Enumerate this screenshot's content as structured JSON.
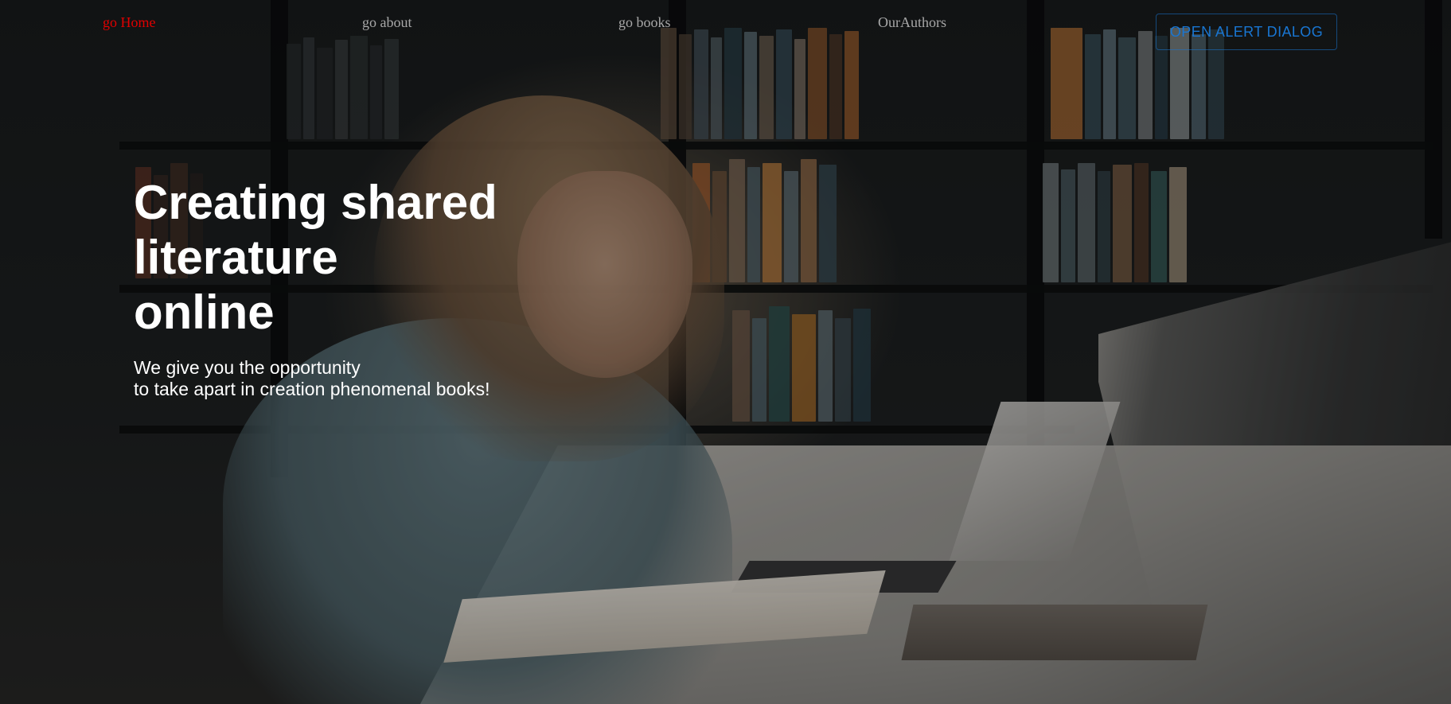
{
  "nav": {
    "items": [
      {
        "label": "go Home",
        "active": true
      },
      {
        "label": "go about",
        "active": false
      },
      {
        "label": "go books",
        "active": false
      },
      {
        "label": "OurAuthors",
        "active": false
      }
    ],
    "alert_button_label": "OPEN ALERT DIALOG"
  },
  "hero": {
    "title_line1": "Creating shared",
    "title_line2": "literature",
    "title_line3": "online",
    "subtitle_line1": "We give you the opportunity",
    "subtitle_line2": "to take apart in creation phenomenal books!",
    "background_image": "library-student-writing"
  },
  "colors": {
    "nav_active": "#e00000",
    "nav_inactive": "#a8a8a8",
    "button_accent": "#1976d2",
    "hero_text": "#ffffff"
  }
}
